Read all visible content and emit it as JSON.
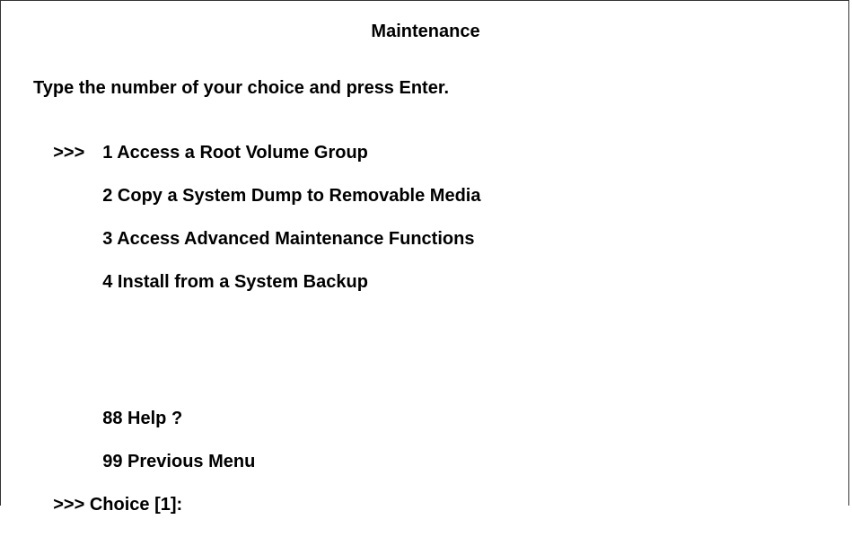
{
  "screen": {
    "title": "Maintenance",
    "prompt": "Type the number of your choice and press Enter.",
    "selection_marker": ">>>",
    "menu_items": [
      {
        "number": "1",
        "label": "Access a Root Volume Group",
        "selected": true
      },
      {
        "number": "2",
        "label": "Copy a System Dump to Removable Media",
        "selected": false
      },
      {
        "number": "3",
        "label": "Access Advanced Maintenance Functions",
        "selected": false
      },
      {
        "number": "4",
        "label": "Install from a System Backup",
        "selected": false
      },
      {
        "number": "88",
        "label": "Help ?",
        "selected": false
      },
      {
        "number": "99",
        "label": "Previous Menu",
        "selected": false
      }
    ],
    "choice_marker": ">>>",
    "choice_label": "Choice [1]:"
  }
}
